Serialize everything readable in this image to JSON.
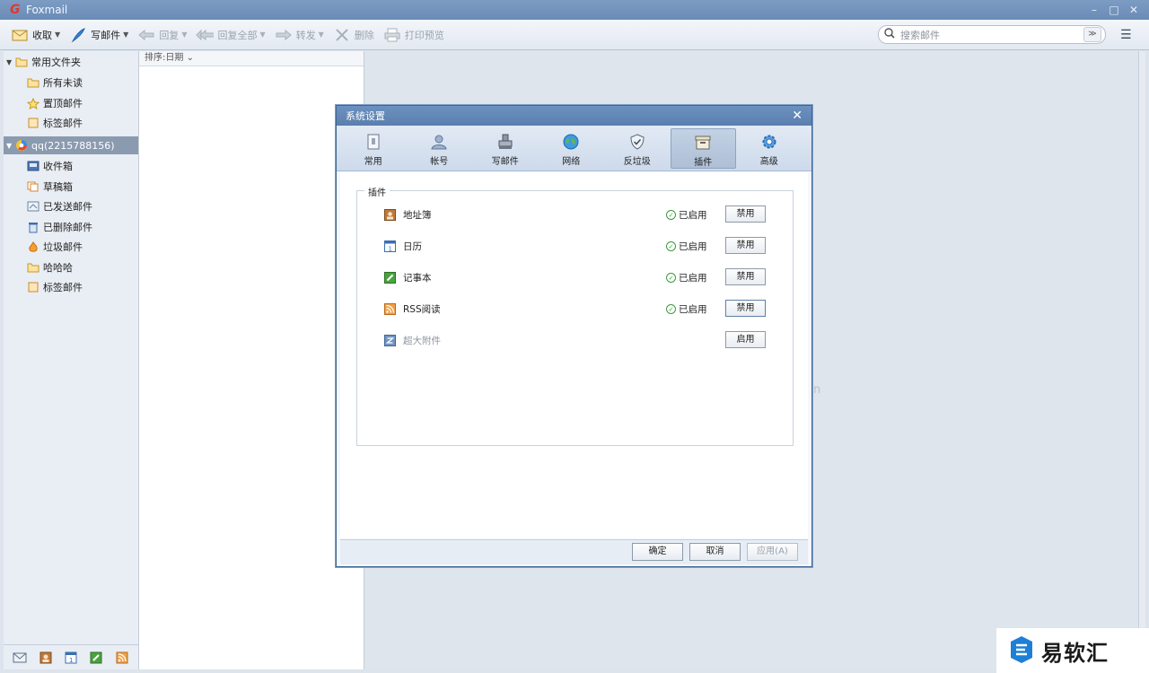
{
  "window": {
    "title": "Foxmail"
  },
  "toolbar": {
    "receive": "收取",
    "compose": "写邮件",
    "reply": "回复",
    "reply_all": "回复全部",
    "forward": "转发",
    "delete": "删除",
    "print_preview": "打印预览",
    "search_placeholder": "搜索邮件"
  },
  "folders": {
    "favorites_label": "常用文件夹",
    "favorites": [
      "所有未读",
      "置顶邮件",
      "标签邮件"
    ],
    "account_label": "qq(2215788156)",
    "account_folders": [
      "收件箱",
      "草稿箱",
      "已发送邮件",
      "已删除邮件",
      "垃圾邮件",
      "哈哈哈",
      "标签邮件"
    ]
  },
  "list": {
    "sort_label": "排序:日期"
  },
  "dialog": {
    "title": "系统设置",
    "tabs": [
      "常用",
      "帐号",
      "写邮件",
      "网络",
      "反垃圾",
      "插件",
      "高级"
    ],
    "active_tab": "插件",
    "group_label": "插件",
    "plugins": [
      {
        "name": "地址簿",
        "status": "已启用",
        "button": "禁用",
        "enabled": true
      },
      {
        "name": "日历",
        "status": "已启用",
        "button": "禁用",
        "enabled": true
      },
      {
        "name": "记事本",
        "status": "已启用",
        "button": "禁用",
        "enabled": true
      },
      {
        "name": "RSS阅读",
        "status": "已启用",
        "button": "禁用",
        "enabled": true
      },
      {
        "name": "超大附件",
        "status": "",
        "button": "启用",
        "enabled": false
      }
    ],
    "ok": "确定",
    "cancel": "取消",
    "apply": "应用(A)"
  },
  "watermark": {
    "text": "易软汇"
  },
  "colors": {
    "titlebar": "#6a8bb6",
    "accent": "#3f6794",
    "ok_green": "#3a9c3a"
  }
}
